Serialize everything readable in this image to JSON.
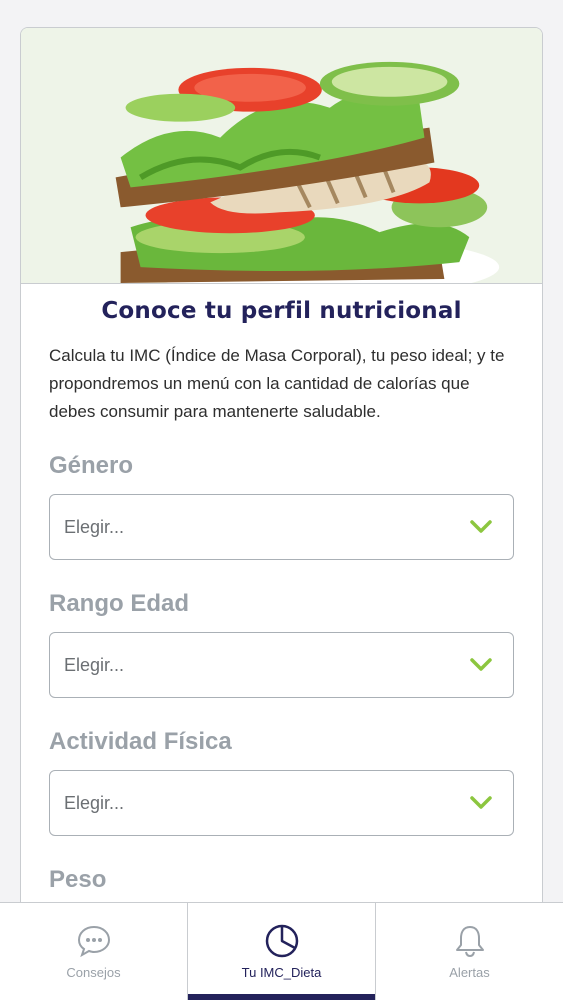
{
  "card": {
    "title": "Conoce tu perfil nutricional",
    "description": "Calcula tu IMC (Índice de Masa Corporal), tu peso ideal; y te propondremos un menú con la cantidad de calorías que debes consumir para mantenerte saludable."
  },
  "form": {
    "genero": {
      "label": "Género",
      "value": "Elegir..."
    },
    "edad": {
      "label": "Rango Edad",
      "value": "Elegir..."
    },
    "actividad": {
      "label": "Actividad Física",
      "value": "Elegir..."
    },
    "peso": {
      "label": "Peso"
    }
  },
  "tabs": [
    {
      "label": "Consejos",
      "icon": "chat-bubble-icon"
    },
    {
      "label": "Tu IMC_Dieta",
      "icon": "pie-chart-icon",
      "active": true
    },
    {
      "label": "Alertas",
      "icon": "bell-icon"
    }
  ],
  "colors": {
    "brand_navy": "#23225b",
    "accent_green": "#8cc63f",
    "muted_label": "#9aa1a8"
  }
}
